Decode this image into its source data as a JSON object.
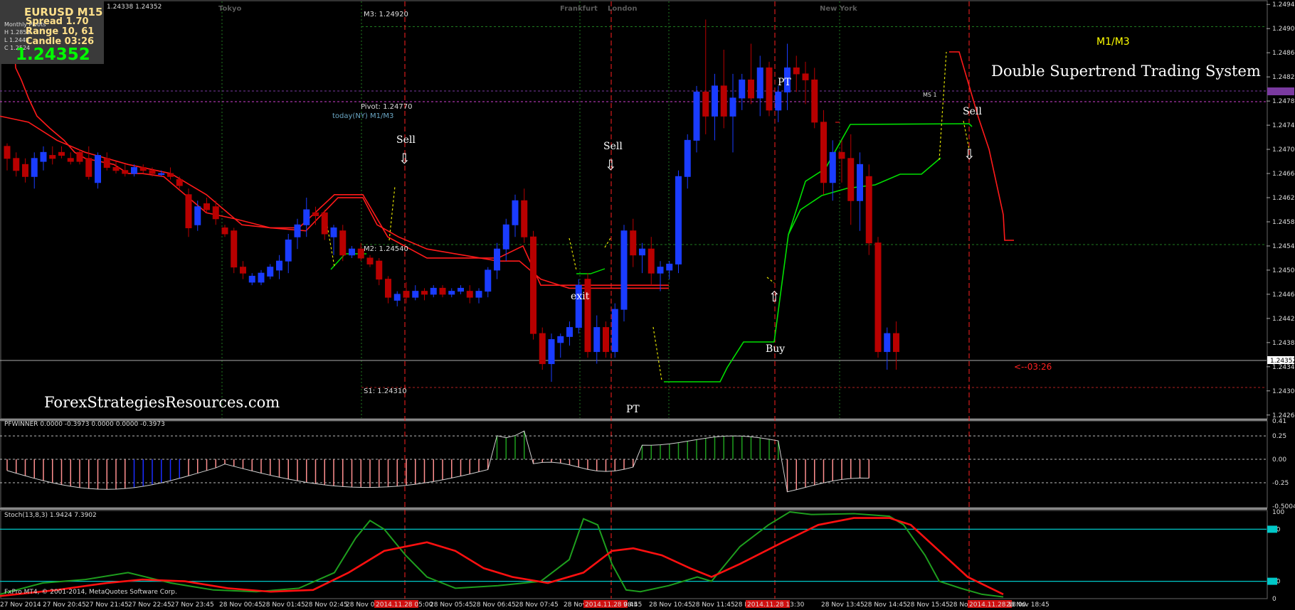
{
  "hud": {
    "symbol": "EURUSD  M15",
    "spread": "Spread   1.70",
    "range": "Range   10, 61",
    "candle": "Candle   03:26",
    "ohlc_mini": [
      "Monthly Pivots",
      "H 1.2854",
      "L 1.2448",
      "C 1.2524"
    ],
    "price": "1.24352"
  },
  "top_quote": "1.24338 1.24352",
  "title": "Double Supertrend Trading System",
  "indicator_tag": "M1/M3",
  "website": "ForexStrategiesResources.com",
  "sessions": [
    "Tokyo",
    "Frankfurt",
    "London",
    "New York"
  ],
  "levels": {
    "m3": "M3: 1.24920",
    "pivot": "Pivot: 1.24770",
    "today": "today(NY) M1/M3",
    "m2": "M2: 1.24540",
    "s1": "S1: 1.24310",
    "ms1": "MS 1"
  },
  "signals": {
    "sell1": "Sell",
    "sell2": "Sell",
    "sell3": "Sell",
    "exit": "exit",
    "pt1": "PT",
    "pt2": "PT",
    "buy": "Buy"
  },
  "countdown": "<--03:26",
  "pfwinner_label": "PFWINNER 0.0000 -0.3973 0.0000 0.0000 -0.3973",
  "stoch_label": "Stoch(13,8,3) 1.9424 7.3902",
  "copyright": "FxPro MT4, © 2001-2014, MetaQuotes Software Corp.",
  "colors": {
    "bull": "#1a3cff",
    "bear": "#b80000",
    "st_red": "#ff1a1a",
    "st_green": "#00e000",
    "transition": "#e0e000",
    "grid": "#1f7a1f",
    "osc_green": "#1e9e1e",
    "osc_red": "#ff1010",
    "level_cyan": "#00c8c8",
    "bar_red": "#ff8f8f",
    "bar_blue": "#1a2cff",
    "bar_green": "#1e9e1e"
  },
  "chart_data": {
    "type": "candlestick",
    "symbol": "EURUSD",
    "timeframe": "M15",
    "price_ticks": [
      "1.24945",
      "1.24905",
      "1.24865",
      "1.24825",
      "1.24785",
      "1.24745",
      "1.24705",
      "1.24665",
      "1.24625",
      "1.24585",
      "1.24545",
      "1.24505",
      "1.24465",
      "1.24425",
      "1.24385",
      "1.24345",
      "1.24305",
      "1.24265"
    ],
    "ylim": [
      1.2426,
      1.2495
    ],
    "current_price": "1.24352",
    "time_labels": [
      "27 Nov 2014",
      "27 Nov 20:45",
      "27 Nov 21:45",
      "27 Nov 22:45",
      "27 Nov 23:45",
      "28 Nov 00:45",
      "28 Nov 01:45",
      "28 Nov 02:45",
      "28 Nov 0",
      "2014.11.28 05:00",
      "28 Nov 05:45",
      "28 Nov 06:45",
      "28 Nov 07:45",
      "28 Nov",
      "2014.11.28 08:45",
      "9:45",
      "28 Nov 10:45",
      "28 Nov 11:45",
      "28 Nov 12:45",
      "2014.11.28 13:30",
      "28 Nov 13:45",
      "28 Nov 14:45",
      "28 Nov 15:45",
      "28 Nov 1",
      "2014.11.28 18:00",
      "28 Nov 18:45"
    ],
    "candles": [
      [
        1.2471,
        1.24715,
        1.2467,
        1.2469
      ],
      [
        1.2469,
        1.247,
        1.2466,
        1.2467
      ],
      [
        1.2468,
        1.2469,
        1.2465,
        1.2466
      ],
      [
        1.2466,
        1.247,
        1.2464,
        1.2469
      ],
      [
        1.24685,
        1.2471,
        1.2467,
        1.247
      ],
      [
        1.24695,
        1.2471,
        1.2468,
        1.2469
      ],
      [
        1.247,
        1.2471,
        1.2469,
        1.24695
      ],
      [
        1.2469,
        1.247,
        1.2468,
        1.24685
      ],
      [
        1.247,
        1.24705,
        1.2468,
        1.24685
      ],
      [
        1.2469,
        1.2471,
        1.24655,
        1.2466
      ],
      [
        1.2465,
        1.247,
        1.2464,
        1.24695
      ],
      [
        1.2469,
        1.247,
        1.2467,
        1.24675
      ],
      [
        1.24675,
        1.24685,
        1.24665,
        1.2467
      ],
      [
        1.2467,
        1.2468,
        1.2466,
        1.24665
      ],
      [
        1.24665,
        1.2468,
        1.2466,
        1.24675
      ],
      [
        1.24675,
        1.2468,
        1.24665,
        1.2467
      ],
      [
        1.2467,
        1.24675,
        1.2466,
        1.24665
      ],
      [
        1.24665,
        1.2467,
        1.2466,
        1.24665
      ],
      [
        1.24665,
        1.24675,
        1.24655,
        1.2466
      ],
      [
        1.24655,
        1.2466,
        1.2464,
        1.24645
      ],
      [
        1.2463,
        1.2464,
        1.2456,
        1.24575
      ],
      [
        1.2458,
        1.2462,
        1.2457,
        1.2461
      ],
      [
        1.24615,
        1.24625,
        1.246,
        1.24605
      ],
      [
        1.2461,
        1.2462,
        1.2458,
        1.2459
      ],
      [
        1.24575,
        1.2458,
        1.2456,
        1.24565
      ],
      [
        1.2457,
        1.24575,
        1.245,
        1.2451
      ],
      [
        1.2451,
        1.2452,
        1.2449,
        1.245
      ],
      [
        1.24485,
        1.245,
        1.2448,
        1.24495
      ],
      [
        1.24485,
        1.24505,
        1.2448,
        1.245
      ],
      [
        1.24495,
        1.24515,
        1.2449,
        1.2451
      ],
      [
        1.24505,
        1.2453,
        1.2449,
        1.2452
      ],
      [
        1.2452,
        1.24565,
        1.245,
        1.24555
      ],
      [
        1.2456,
        1.2459,
        1.2454,
        1.2458
      ],
      [
        1.2458,
        1.24625,
        1.2456,
        1.24605
      ],
      [
        1.246,
        1.2461,
        1.2458,
        1.24595
      ],
      [
        1.246,
        1.24605,
        1.24555,
        1.24565
      ],
      [
        1.2456,
        1.2458,
        1.2453,
        1.24575
      ],
      [
        1.2457,
        1.2458,
        1.2452,
        1.2453
      ],
      [
        1.2453,
        1.24545,
        1.24525,
        1.2454
      ],
      [
        1.2454,
        1.2455,
        1.2452,
        1.24525
      ],
      [
        1.24525,
        1.2453,
        1.2451,
        1.24515
      ],
      [
        1.2452,
        1.24525,
        1.2448,
        1.2449
      ],
      [
        1.2449,
        1.24495,
        1.2445,
        1.2446
      ],
      [
        1.24455,
        1.2447,
        1.24445,
        1.24465
      ],
      [
        1.2447,
        1.24485,
        1.2445,
        1.2446
      ],
      [
        1.2446,
        1.2448,
        1.24455,
        1.2447
      ],
      [
        1.2447,
        1.24475,
        1.24455,
        1.24465
      ],
      [
        1.24465,
        1.2448,
        1.2446,
        1.24475
      ],
      [
        1.24475,
        1.2448,
        1.2446,
        1.24465
      ],
      [
        1.24465,
        1.24475,
        1.2446,
        1.2447
      ],
      [
        1.2447,
        1.2448,
        1.24465,
        1.24475
      ],
      [
        1.2447,
        1.2448,
        1.2445,
        1.2446
      ],
      [
        1.2446,
        1.24475,
        1.2445,
        1.2447
      ],
      [
        1.2447,
        1.2451,
        1.2446,
        1.24505
      ],
      [
        1.24505,
        1.2455,
        1.2449,
        1.2454
      ],
      [
        1.2454,
        1.2459,
        1.2452,
        1.2458
      ],
      [
        1.2458,
        1.2463,
        1.2456,
        1.2462
      ],
      [
        1.2462,
        1.2464,
        1.2455,
        1.2456
      ],
      [
        1.2456,
        1.2457,
        1.2439,
        1.244
      ],
      [
        1.244,
        1.2441,
        1.2434,
        1.2435
      ],
      [
        1.2435,
        1.244,
        1.2432,
        1.2439
      ],
      [
        1.24385,
        1.244,
        1.2436,
        1.24395
      ],
      [
        1.24395,
        1.2442,
        1.2438,
        1.2441
      ],
      [
        1.2441,
        1.2449,
        1.244,
        1.2448
      ],
      [
        1.2449,
        1.245,
        1.2436,
        1.2437
      ],
      [
        1.2437,
        1.2443,
        1.2435,
        1.2441
      ],
      [
        1.2441,
        1.2442,
        1.2436,
        1.2437
      ],
      [
        1.2437,
        1.2445,
        1.2436,
        1.2444
      ],
      [
        1.2444,
        1.2458,
        1.2442,
        1.2457
      ],
      [
        1.2457,
        1.2459,
        1.2451,
        1.2453
      ],
      [
        1.2453,
        1.2455,
        1.245,
        1.2454
      ],
      [
        1.2454,
        1.2456,
        1.2448,
        1.245
      ],
      [
        1.245,
        1.2452,
        1.2447,
        1.2451
      ],
      [
        1.24505,
        1.2452,
        1.2449,
        1.24515
      ],
      [
        1.24515,
        1.2467,
        1.245,
        1.2466
      ],
      [
        1.2466,
        1.2473,
        1.2464,
        1.2472
      ],
      [
        1.2472,
        1.2481,
        1.247,
        1.248
      ],
      [
        1.248,
        1.2492,
        1.2473,
        1.2476
      ],
      [
        1.2476,
        1.2483,
        1.2472,
        1.2481
      ],
      [
        1.2481,
        1.2487,
        1.2474,
        1.2476
      ],
      [
        1.2476,
        1.2483,
        1.247,
        1.2479
      ],
      [
        1.2479,
        1.2483,
        1.2477,
        1.2482
      ],
      [
        1.2482,
        1.2488,
        1.2478,
        1.2479
      ],
      [
        1.2479,
        1.2486,
        1.2476,
        1.2484
      ],
      [
        1.2484,
        1.2485,
        1.2476,
        1.2477
      ],
      [
        1.2477,
        1.2481,
        1.2475,
        1.248
      ],
      [
        1.248,
        1.2488,
        1.2477,
        1.2484
      ],
      [
        1.2484,
        1.2486,
        1.248,
        1.2483
      ],
      [
        1.2483,
        1.2485,
        1.2478,
        1.2482
      ],
      [
        1.2482,
        1.2484,
        1.2474,
        1.2475
      ],
      [
        1.2475,
        1.2477,
        1.2463,
        1.2465
      ],
      [
        1.2465,
        1.2472,
        1.2462,
        1.247
      ],
      [
        1.247,
        1.2472,
        1.2465,
        1.2469
      ],
      [
        1.2469,
        1.2473,
        1.2458,
        1.2462
      ],
      [
        1.2462,
        1.247,
        1.2457,
        1.2468
      ],
      [
        1.2466,
        1.2468,
        1.2453,
        1.2455
      ],
      [
        1.2455,
        1.2456,
        1.2436,
        1.2437
      ],
      [
        1.2437,
        1.2441,
        1.2434,
        1.244
      ],
      [
        1.244,
        1.2442,
        1.2434,
        1.2437
      ]
    ],
    "supertrend_red": [
      [
        0,
        1.2488
      ],
      [
        20,
        1.2488
      ],
      [
        22,
        1.2484
      ],
      [
        30,
        1.2482
      ],
      [
        40,
        1.2479
      ],
      [
        52,
        1.2476
      ],
      [
        70,
        1.2474
      ],
      [
        90,
        1.2472
      ],
      [
        105,
        1.247
      ],
      [
        120,
        1.2469
      ],
      [
        160,
        1.2468
      ],
      [
        180,
        1.24665
      ],
      [
        200,
        1.24665
      ],
      [
        230,
        1.2466
      ],
      [
        260,
        1.2463
      ],
      [
        290,
        1.246
      ],
      [
        330,
        1.2459
      ],
      [
        380,
        1.24575
      ],
      [
        430,
        1.2457
      ],
      [
        475,
        1.24625
      ],
      [
        510,
        1.24625
      ],
      [
        530,
        1.2458
      ],
      [
        560,
        1.2456
      ],
      [
        600,
        1.2454
      ],
      [
        650,
        1.2453
      ],
      [
        700,
        1.2452
      ],
      [
        730,
        1.2452
      ],
      [
        760,
        1.2449
      ],
      [
        800,
        1.24475
      ],
      [
        880,
        1.24475
      ],
      [
        940,
        1.24475
      ]
    ],
    "supertrend_upper": [
      [
        0,
        1.2476
      ],
      [
        40,
        1.2475
      ],
      [
        80,
        1.2472
      ],
      [
        120,
        1.247
      ],
      [
        180,
        1.2468
      ],
      [
        240,
        1.24665
      ],
      [
        290,
        1.2463
      ],
      [
        340,
        1.2458
      ],
      [
        380,
        1.24575
      ],
      [
        420,
        1.24575
      ],
      [
        470,
        1.2463
      ],
      [
        510,
        1.2463
      ],
      [
        545,
        1.2456
      ],
      [
        600,
        1.24525
      ],
      [
        660,
        1.24525
      ],
      [
        700,
        1.24525
      ],
      [
        735,
        1.24545
      ],
      [
        760,
        1.2448
      ],
      [
        820,
        1.2448
      ],
      [
        940,
        1.2448
      ]
    ],
    "supertrend_green": [
      [
        940,
        1.24395
      ],
      [
        950,
        1.24525
      ],
      [
        990,
        1.24645
      ],
      [
        1030,
        1.2474
      ],
      [
        1100,
        1.24745
      ],
      [
        1170,
        1.24745
      ],
      [
        1170,
        1.2466
      ]
    ],
    "supertrend_green_lower": [
      [
        410,
        1.2449
      ],
      [
        430,
        1.2451
      ],
      [
        480,
        1.2451
      ],
      [
        700,
        1.245
      ],
      [
        740,
        1.245
      ]
    ],
    "pfwinner": {
      "ylim": [
        -0.5004,
        0.41
      ],
      "ticks": [
        "0.41",
        "0.25",
        "0.00",
        "-0.25",
        "-0.5004"
      ]
    },
    "stoch": {
      "ylim": [
        0,
        100
      ],
      "levels": [
        80,
        20
      ],
      "ticks": [
        "100",
        "80",
        "20",
        "0"
      ]
    }
  }
}
